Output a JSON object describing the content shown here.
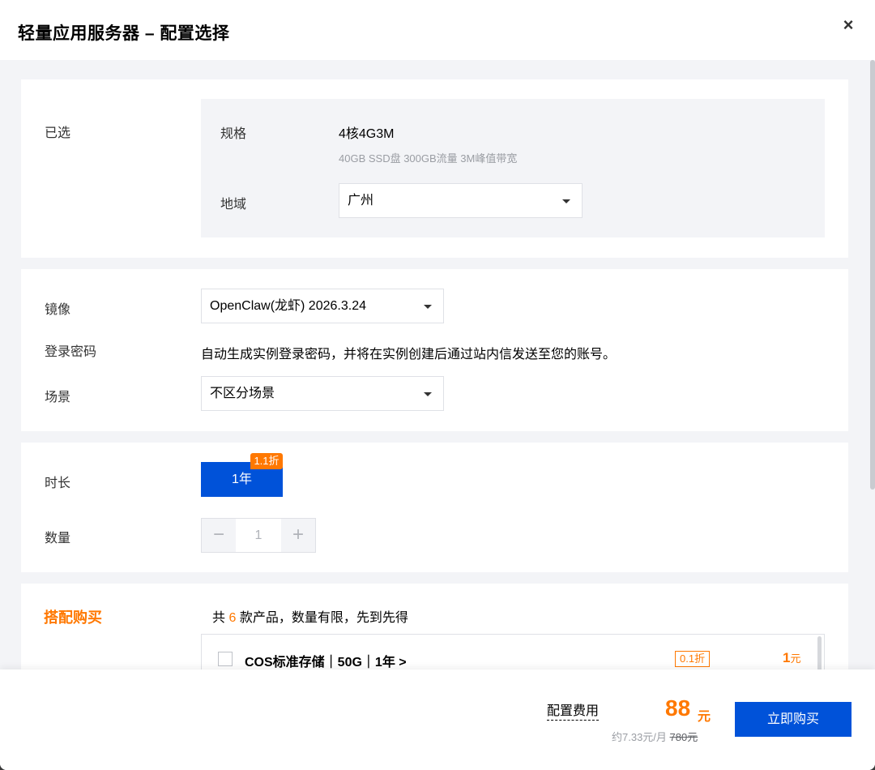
{
  "header": {
    "title": "轻量应用服务器 – 配置选择",
    "close_icon": "close-icon"
  },
  "selected": {
    "label": "已选",
    "spec_label": "规格",
    "spec_value": "4核4G3M",
    "spec_detail": "40GB SSD盘 300GB流量 3M峰值带宽",
    "region_label": "地域",
    "region_value": "广州"
  },
  "image_section": {
    "image_label": "镜像",
    "image_value": "OpenClaw(龙虾) 2026.3.24",
    "password_label": "登录密码",
    "password_text": "自动生成实例登录密码，并将在实例创建后通过站内信发送至您的账号。",
    "scene_label": "场景",
    "scene_value": "不区分场景"
  },
  "duration_section": {
    "duration_label": "时长",
    "duration_option": "1年",
    "discount_badge": "1.1折",
    "quantity_label": "数量",
    "quantity_value": "1",
    "minus_symbol": "−",
    "plus_symbol": "+"
  },
  "combo_section": {
    "label": "搭配购买",
    "text_prefix": "共",
    "count": "6",
    "text_suffix": "款产品，数量有限，先到先得",
    "items": [
      {
        "name": "COS标准存储｜50G｜1年 >",
        "discount": "0.1折",
        "price": "1",
        "unit": "元"
      }
    ]
  },
  "footer": {
    "fee_label": "配置费用",
    "fee_value": "88",
    "fee_unit": "元",
    "monthly": "约7.33元/月",
    "original_price": "780元",
    "buy_button": "立即购买"
  },
  "colors": {
    "primary": "#0052d9",
    "accent": "#ff7800"
  }
}
